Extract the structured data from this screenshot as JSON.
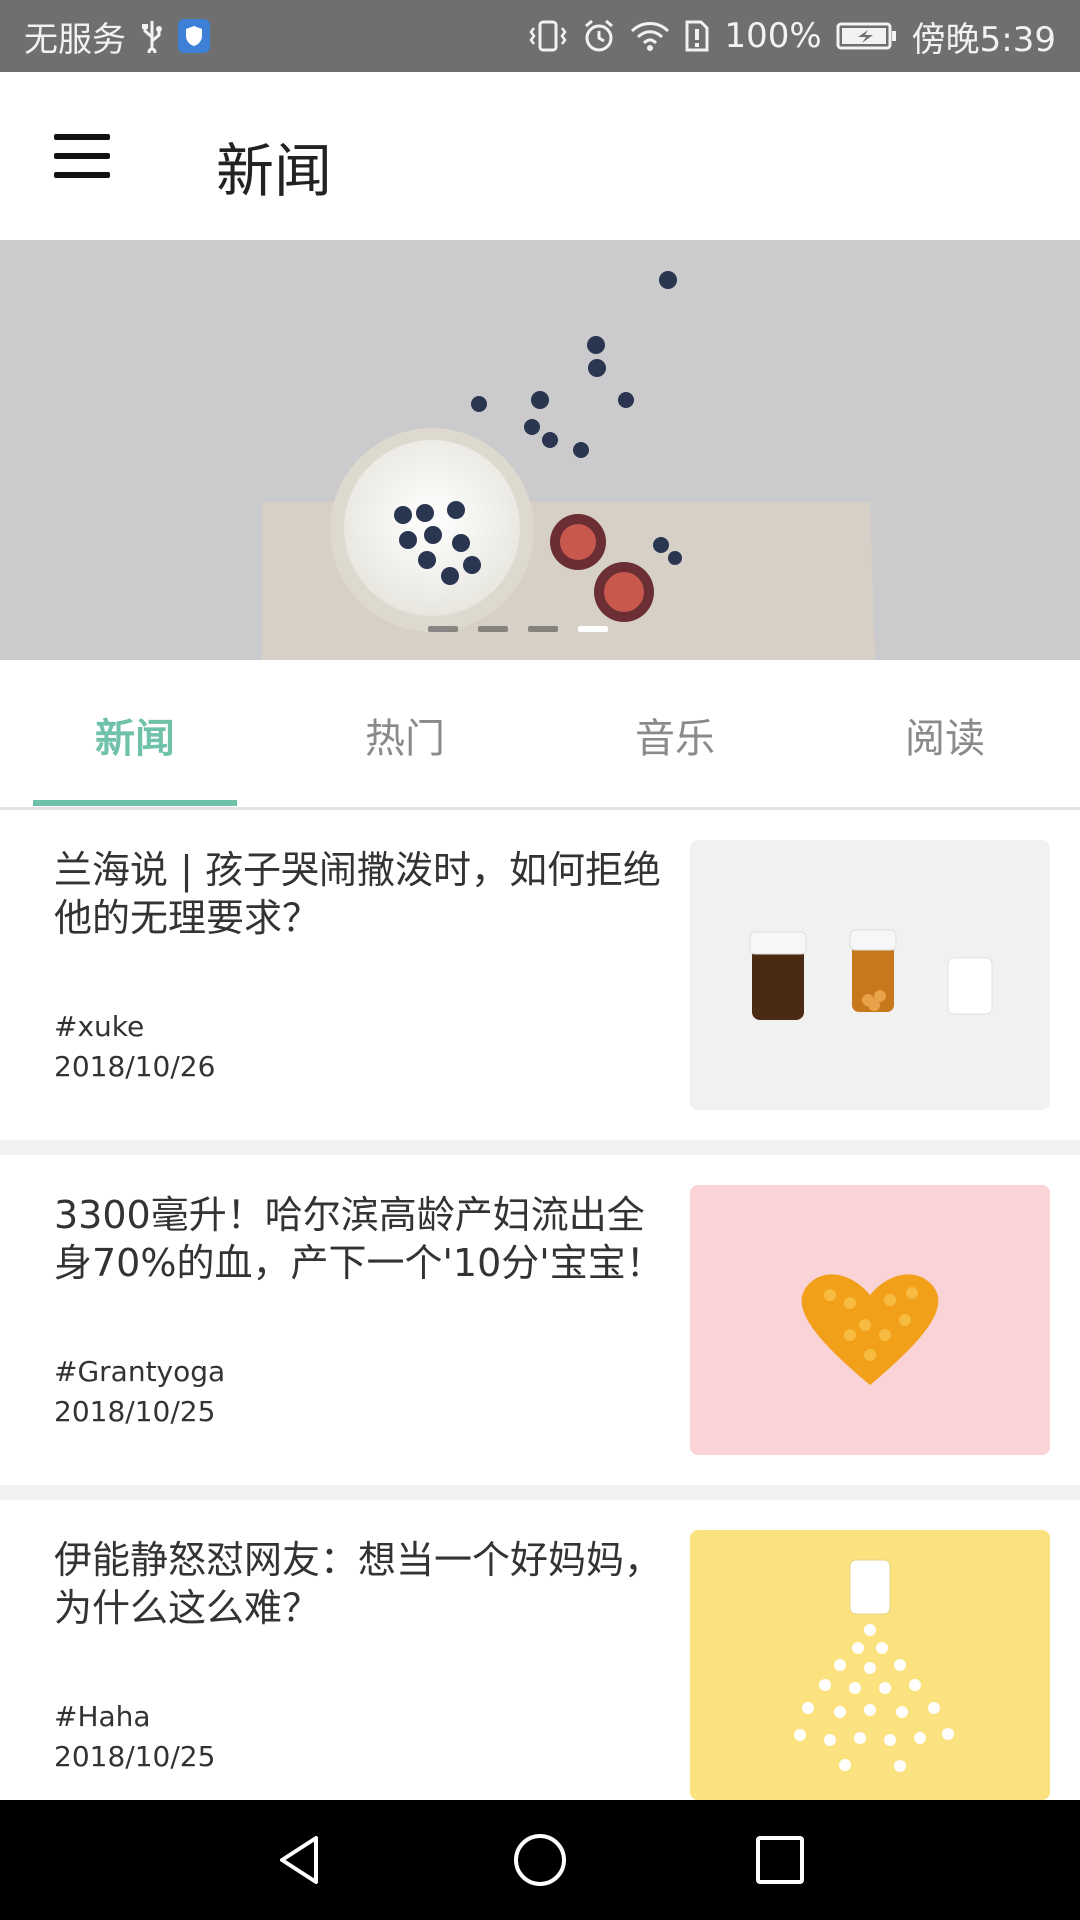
{
  "status_bar": {
    "carrier": "无服务",
    "battery_percent": "100%",
    "time": "傍晚5:39",
    "icons": [
      "usb-icon",
      "shield-icon",
      "vibrate-icon",
      "alarm-icon",
      "wifi-icon",
      "sim-icon",
      "battery-icon"
    ]
  },
  "app_bar": {
    "title": "新闻",
    "menu_icon": "menu-icon"
  },
  "banner": {
    "indicator_count": 4,
    "active_index": 3
  },
  "tabs": [
    {
      "label": "新闻",
      "active": true
    },
    {
      "label": "热门",
      "active": false
    },
    {
      "label": "音乐",
      "active": false
    },
    {
      "label": "阅读",
      "active": false
    }
  ],
  "articles": [
    {
      "title": "兰海说 | 孩子哭闹撒泼时，如何拒绝他的无理要求？",
      "tag": "#xuke",
      "date": "2018/10/26",
      "thumb": "medicine-bottles-image",
      "thumb_bg": "#f1f1f1"
    },
    {
      "title": "3300毫升！哈尔滨高龄产妇流出全身70%的血，产下一个'10分'宝宝！",
      "tag": "#Grantyoga",
      "date": "2018/10/25",
      "thumb": "pill-heart-image",
      "thumb_bg": "#f9d3d6"
    },
    {
      "title": "伊能静怒怼网友：想当一个好妈妈，为什么这么难？",
      "tag": "#Haha",
      "date": "2018/10/25",
      "thumb": "spilled-pills-image",
      "thumb_bg": "#fbe27e"
    }
  ],
  "colors": {
    "accent": "#6fc1a9",
    "status_bar": "#6f6f6f",
    "nav_bar": "#000000"
  },
  "nav_bar": [
    "back-icon",
    "home-icon",
    "recents-icon"
  ]
}
